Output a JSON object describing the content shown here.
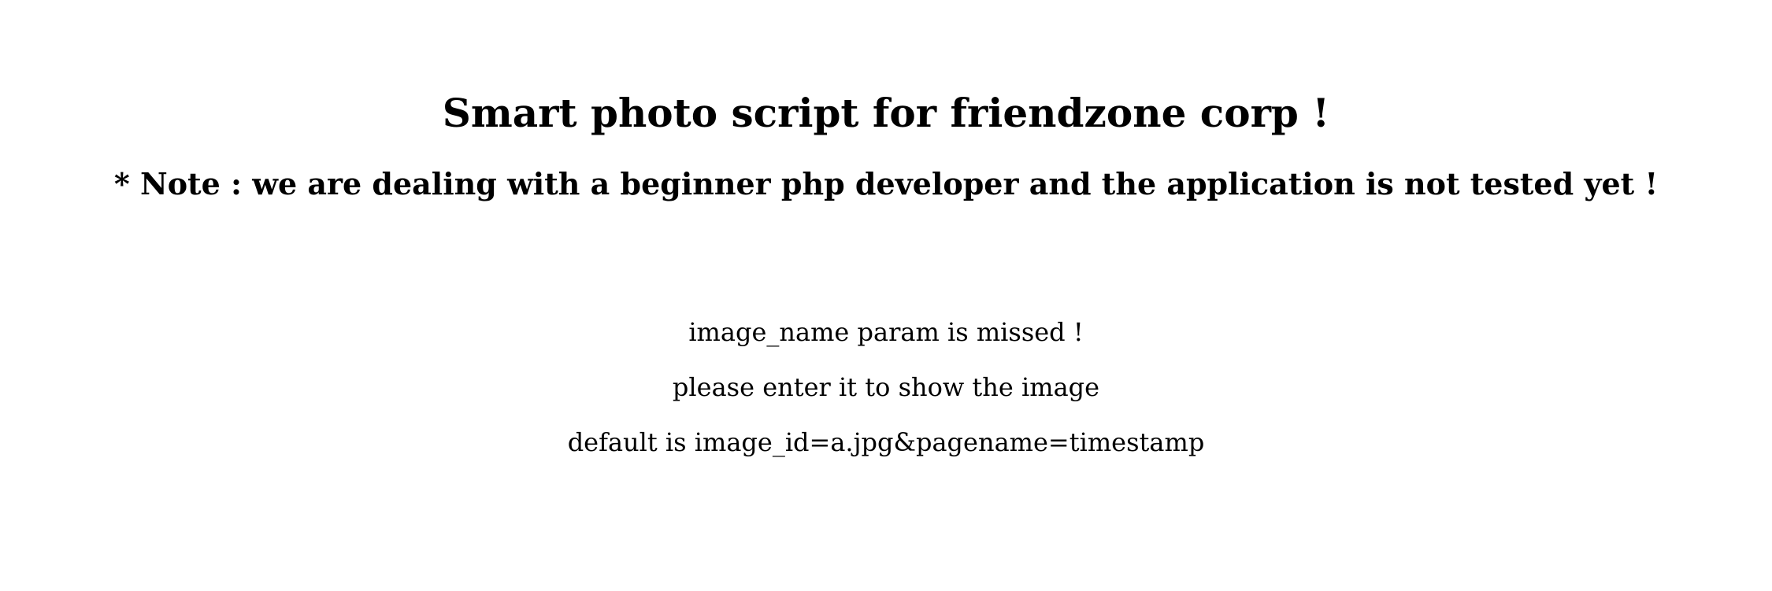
{
  "heading": "Smart photo script for friendzone corp !",
  "note": "* Note : we are dealing with a beginner php developer and the application is not tested yet !",
  "messages": [
    "image_name param is missed !",
    "please enter it to show the image",
    "default is image_id=a.jpg&pagename=timestamp"
  ]
}
